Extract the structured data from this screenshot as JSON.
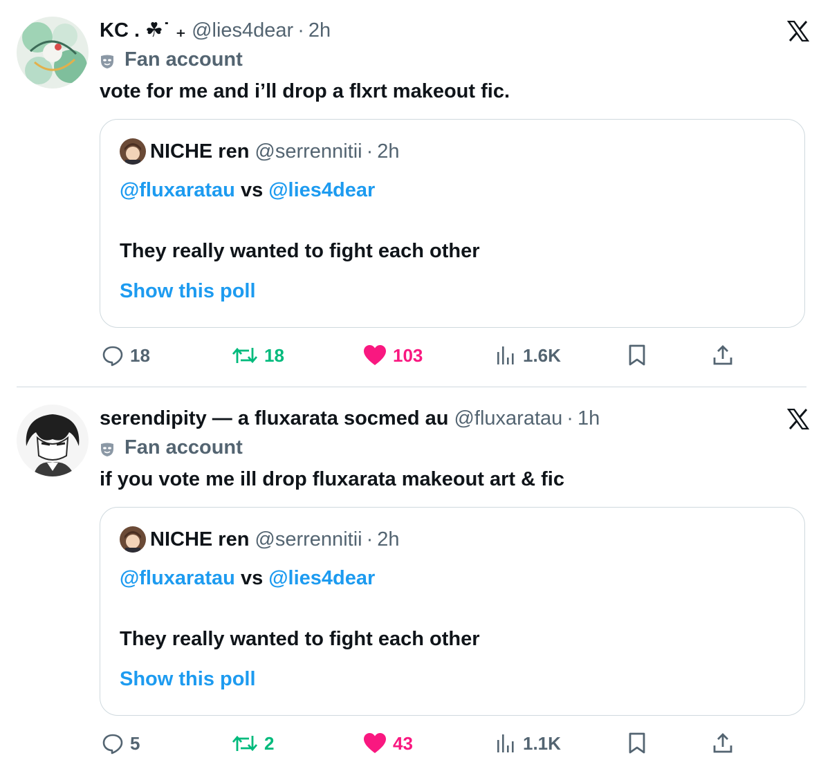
{
  "tweets": [
    {
      "name": "KC . ☘︎˙ ₊",
      "handle": "@lies4dear",
      "time": "2h",
      "label": "Fan account",
      "text": "vote for me and i’ll drop a flxrt makeout fic.",
      "quote": {
        "name": "NICHE ren",
        "handle": "@serrennitii",
        "time": "2h",
        "mention_a": "@fluxaratau",
        "vs": "vs",
        "mention_b": "@lies4dear",
        "body": "They really wanted to fight each other",
        "link": "Show this poll"
      },
      "stats": {
        "replies": "18",
        "retweets": "18",
        "likes": "103",
        "views": "1.6K"
      }
    },
    {
      "name": "serendipity — a fluxarata socmed au",
      "handle": "@fluxaratau",
      "time": "1h",
      "label": "Fan account",
      "text": "if you vote me ill drop fluxarata makeout art & fic",
      "quote": {
        "name": "NICHE ren",
        "handle": "@serrennitii",
        "time": "2h",
        "mention_a": "@fluxaratau",
        "vs": "vs",
        "mention_b": "@lies4dear",
        "body": "They really wanted to fight each other",
        "link": "Show this poll"
      },
      "stats": {
        "replies": "5",
        "retweets": "2",
        "likes": "43",
        "views": "1.1K"
      }
    }
  ],
  "separator": "·",
  "colors": {
    "link": "#1d9bf0",
    "retweet": "#00ba7c",
    "like": "#f91880",
    "muted": "#536471",
    "border": "#cfd9de"
  },
  "icons": [
    "x-logo-icon",
    "mask-icon",
    "reply-icon",
    "retweet-icon",
    "heart-icon",
    "views-icon",
    "bookmark-icon",
    "share-icon"
  ]
}
